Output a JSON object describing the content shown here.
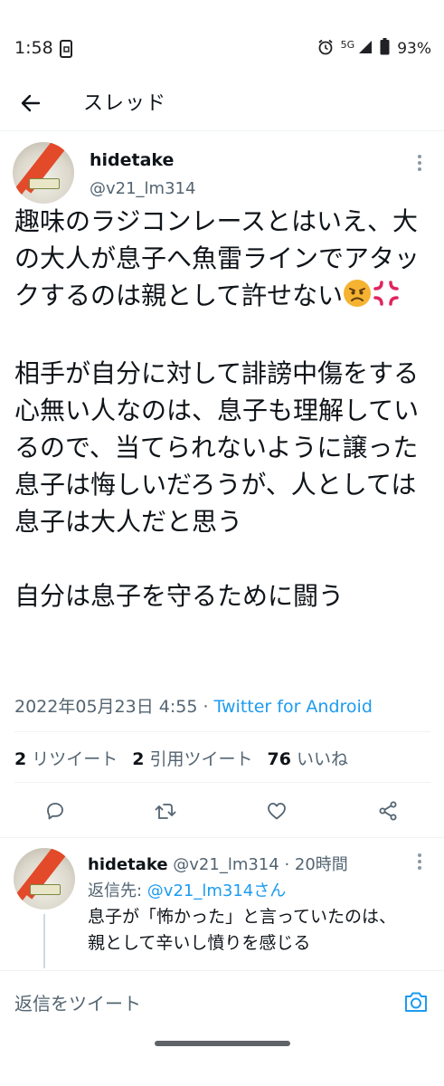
{
  "status_bar": {
    "time": "1:58",
    "network": "5G",
    "battery": "93%",
    "icons": [
      "alarm-icon",
      "signal-icon",
      "battery-icon"
    ]
  },
  "header": {
    "title": "スレッド",
    "back_icon": "back-arrow-icon"
  },
  "tweet": {
    "author_name": "hidetake",
    "author_handle": "@v21_lm314",
    "text_para1": "趣味のラジコンレースとはいえ、大の大人が息子へ魚雷ラインでアタックするのは親として許せない",
    "text_para1_emojis": [
      "angry-face-emoji",
      "anger-symbol-emoji"
    ],
    "text_para2": "相手が自分に対して誹謗中傷をする心無い人なのは、息子も理解しているので、当てられないように譲った息子は悔しいだろうが、人としては息子は大人だと思う",
    "text_para3": "自分は息子を守るために闘う",
    "timestamp": "2022年05月23日 4:55",
    "separator": " · ",
    "source": "Twitter for Android",
    "stats": {
      "retweets_count": "2",
      "retweets_label": "リツイート",
      "quotes_count": "2",
      "quotes_label": "引用ツイート",
      "likes_count": "76",
      "likes_label": "いいね"
    },
    "actions": [
      "reply-icon",
      "retweet-icon",
      "like-icon",
      "share-icon"
    ]
  },
  "reply": {
    "author_name": "hidetake",
    "author_handle": "@v21_lm314",
    "time": "· 20時間",
    "reply_to_label": "返信先: ",
    "reply_to_user": "@v21_lm314さん",
    "text": "息子が「怖かった」と言っていたのは、親として辛いし憤りを感じる"
  },
  "composer": {
    "placeholder": "返信をツイート",
    "camera_icon": "camera-icon"
  },
  "colors": {
    "accent": "#1d9bf0",
    "text": "#0f1419",
    "secondary": "#536471",
    "divider": "#eff3f4"
  }
}
